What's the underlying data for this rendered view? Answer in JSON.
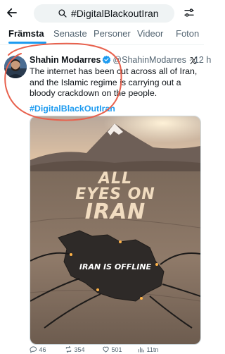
{
  "search": {
    "query": "#DigitalBlackoutIran"
  },
  "tabs": [
    {
      "label": "Främsta",
      "active": true
    },
    {
      "label": "Senaste"
    },
    {
      "label": "Personer"
    },
    {
      "label": "Videor"
    },
    {
      "label": "Foton"
    }
  ],
  "tweet": {
    "author_name": "Shahin Modarres",
    "handle": "@ShahinModarres",
    "separator": "·",
    "time": "12 h",
    "text": "The internet has been cut across all of Iran, and the Islamic regime is carrying out a bloody crackdown on the people.",
    "hashtag": "#DigitalBlackOutIran",
    "media": {
      "line1": "ALL",
      "line2": "EYES ON",
      "line3": "IRAN",
      "caption": "IRAN IS OFFLINE"
    },
    "actions": {
      "replies": "46",
      "reposts": "354",
      "likes": "501",
      "views": "11tn"
    }
  },
  "colors": {
    "accent": "#1d9bf0",
    "annotation": "#e8614d",
    "text": "#0f1419",
    "muted": "#536471"
  },
  "icons": [
    "back-arrow-icon",
    "search-icon",
    "filter-sliders-icon",
    "verified-icon",
    "x-logo-icon",
    "reply-icon",
    "repost-icon",
    "like-icon",
    "views-icon"
  ]
}
